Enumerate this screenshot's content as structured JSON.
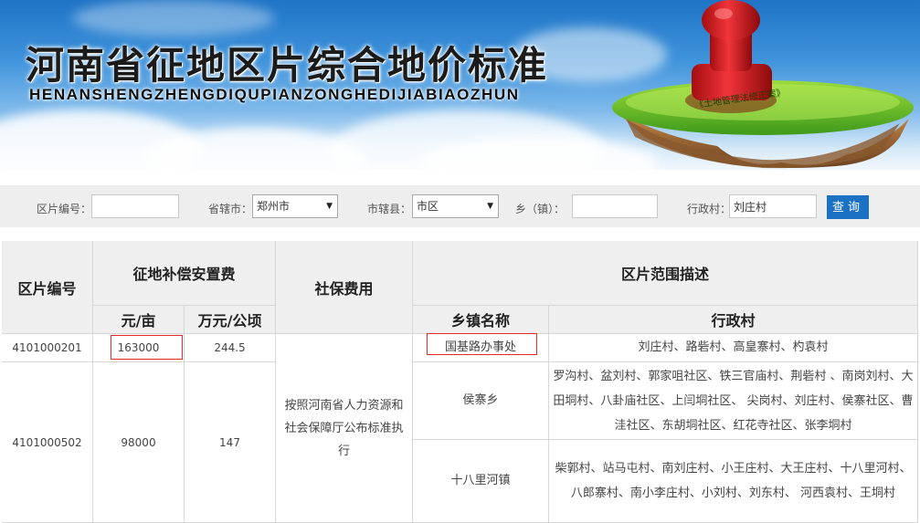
{
  "banner": {
    "title": "河南省征地区片综合地价标准",
    "subtitle": "HENANSHENGZHENGDIQUPIANZONGHEDIJIABIAOZHUN",
    "badge_text": "《土地管理法修正案》"
  },
  "search": {
    "zone_code_label": "区片编号：",
    "zone_code_value": "",
    "city_label": "省辖市：",
    "city_value": "郑州市",
    "county_label": "市辖县：",
    "county_value": "市区",
    "township_label": "乡（镇）：",
    "township_value": "",
    "village_label": "行政村：",
    "village_value": "刘庄村",
    "query_button": "查询"
  },
  "table": {
    "headers": {
      "zone_code": "区片编号",
      "compensation": "征地补偿安置费",
      "yuan_per_mu": "元/亩",
      "wan_per_ha": "万元/公顷",
      "social_security": "社保费用",
      "range": "区片范围描述",
      "township": "乡镇名称",
      "village": "行政村"
    },
    "social_security_text": "按照河南省人力资源和社会保障厅公布标准执行",
    "rows": [
      {
        "zone_code": "4101000201",
        "yuan_per_mu": "163000",
        "wan_per_ha": "244.5",
        "townships": [
          {
            "name": "国基路办事处",
            "villages": "刘庄村、路砦村、高皇寨村、杓袁村"
          }
        ]
      },
      {
        "zone_code": "4101000502",
        "yuan_per_mu": "98000",
        "wan_per_ha": "147",
        "townships": [
          {
            "name": "侯寨乡",
            "villages": "罗沟村、盆刘村、郭家咀社区、铁三官庙村、荆砦村 、南岗刘村、大田垌村、八卦庙社区、上闫垌社区、 尖岗村、刘庄村、侯寨社区、曹洼社区、东胡垌社区、红花寺社区、张李垌村"
          },
          {
            "name": "十八里河镇",
            "villages": "柴郭村、站马屯村、南刘庄村、小王庄村、大王庄村、十八里河村、八郎寨村、南小李庄村、小刘村、刘东村、 河西袁村、王垌村"
          }
        ]
      }
    ]
  },
  "colors": {
    "accent": "#1b72c5",
    "highlight_border": "#e12a2a",
    "header_bg": "#efefef"
  }
}
